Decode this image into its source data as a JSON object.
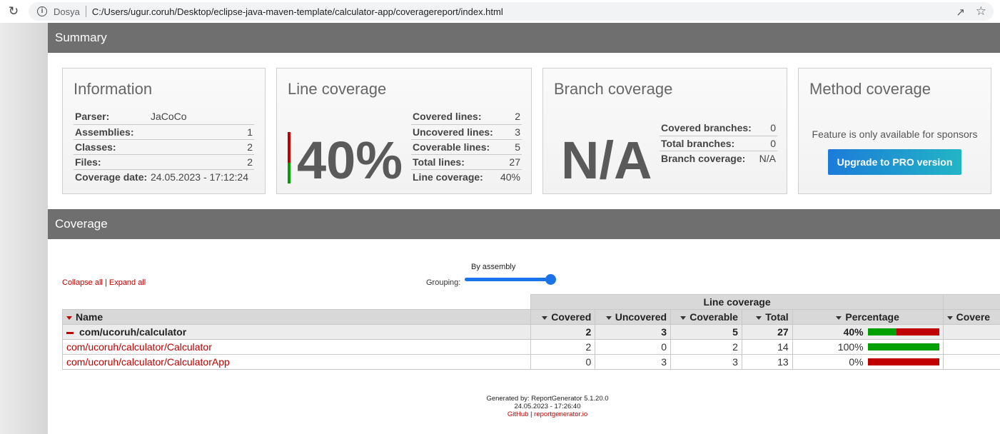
{
  "browser": {
    "origin": "Dosya",
    "path": "C:/Users/ugur.coruh/Desktop/eclipse-java-maven-template/calculator-app/coveragereport/index.html"
  },
  "summary_header": "Summary",
  "coverage_header": "Coverage",
  "information": {
    "title": "Information",
    "rows": [
      {
        "key": "Parser:",
        "value": "JaCoCo"
      },
      {
        "key": "Assemblies:",
        "value": "1"
      },
      {
        "key": "Classes:",
        "value": "2"
      },
      {
        "key": "Files:",
        "value": "2"
      },
      {
        "key": "Coverage date:",
        "value": "24.05.2023 - 17:12:24"
      }
    ]
  },
  "line_coverage": {
    "title": "Line coverage",
    "percent_label": "40%",
    "covered_fraction": 0.4,
    "rows": [
      {
        "key": "Covered lines:",
        "value": "2"
      },
      {
        "key": "Uncovered lines:",
        "value": "3"
      },
      {
        "key": "Coverable lines:",
        "value": "5"
      },
      {
        "key": "Total lines:",
        "value": "27"
      },
      {
        "key": "Line coverage:",
        "value": "40%"
      }
    ]
  },
  "branch_coverage": {
    "title": "Branch coverage",
    "big_label": "N/A",
    "rows": [
      {
        "key": "Covered branches:",
        "value": "0"
      },
      {
        "key": "Total branches:",
        "value": "0"
      },
      {
        "key": "Branch coverage:",
        "value": "N/A"
      }
    ]
  },
  "method_coverage": {
    "title": "Method coverage",
    "notice": "Feature is only available for sponsors",
    "button_label": "Upgrade to PRO version"
  },
  "controls": {
    "collapse_all": "Collapse all",
    "separator": "|",
    "expand_all": "Expand all",
    "grouping_label": "Grouping:",
    "grouping_value": "By assembly"
  },
  "table": {
    "group_header": "Line coverage",
    "columns": [
      "Name",
      "Covered",
      "Uncovered",
      "Coverable",
      "Total",
      "Percentage",
      "Covere"
    ],
    "group_row": {
      "name": "com/ucoruh/calculator",
      "covered": "2",
      "uncovered": "3",
      "coverable": "5",
      "total": "27",
      "percentage": "40%",
      "fraction": 0.4
    },
    "rows": [
      {
        "name": "com/ucoruh/calculator/Calculator",
        "covered": "2",
        "uncovered": "0",
        "coverable": "2",
        "total": "14",
        "percentage": "100%",
        "fraction": 1.0
      },
      {
        "name": "com/ucoruh/calculator/CalculatorApp",
        "covered": "0",
        "uncovered": "3",
        "coverable": "3",
        "total": "13",
        "percentage": "0%",
        "fraction": 0.0
      }
    ]
  },
  "footer": {
    "generated_by": "Generated by: ReportGenerator 5.1.20.0",
    "date": "24.05.2023 - 17:26:40",
    "github": "GitHub",
    "separator": "|",
    "site": "reportgenerator.io"
  },
  "colors": {
    "covered": "#00a000",
    "uncovered": "#c00000",
    "header_bg": "#6f6f6f",
    "link": "#c00000",
    "button_start": "#1c7bd9",
    "button_end": "#22b5c5"
  }
}
